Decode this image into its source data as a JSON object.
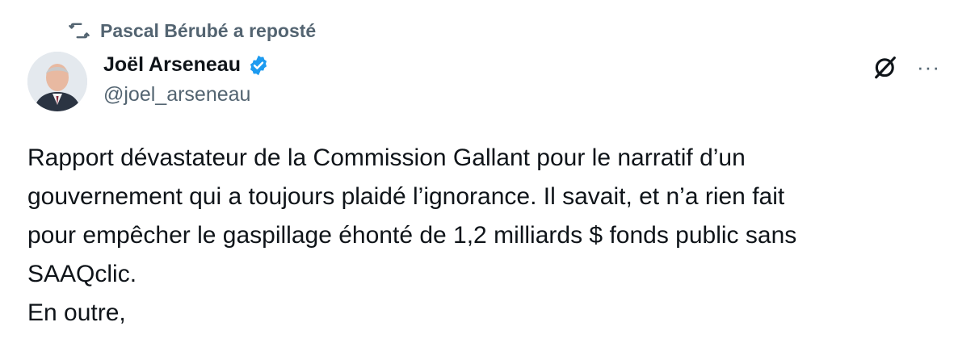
{
  "repost": {
    "text": "Pascal Bérubé a reposté",
    "icon": "repost-icon"
  },
  "author": {
    "name": "Joël Arseneau",
    "handle": "@joel_arseneau",
    "verified": true,
    "verified_color": "#1d9bf0"
  },
  "actions": {
    "grok_icon": "grok-icon",
    "more_icon": "more-icon",
    "more_label": "···"
  },
  "tweet": {
    "lines": [
      "Rapport dévastateur de la Commission Gallant pour le narratif d’un",
      "gouvernement qui a toujours plaidé l’ignorance. Il savait, et n’a rien fait",
      "pour empêcher le gaspillage éhonté de 1,2 milliards $ fonds public sans",
      "SAAQclic.",
      "En outre,"
    ]
  },
  "colors": {
    "text": "#0f1419",
    "secondary": "#536471"
  }
}
